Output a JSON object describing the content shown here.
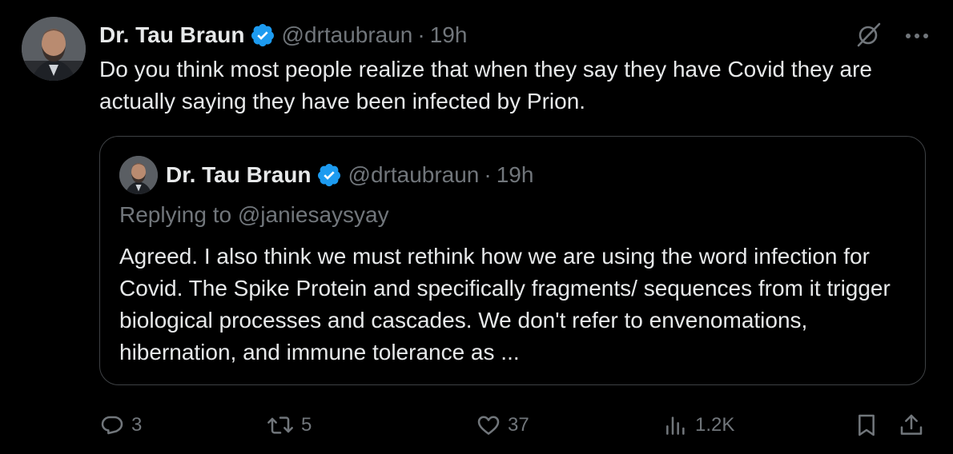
{
  "tweet": {
    "author_name": "Dr. Tau Braun",
    "handle": "@drtaubraun",
    "separator": "·",
    "time": "19h",
    "text": "Do you think most people realize that when they say they have Covid they are actually saying they have been infected by Prion.",
    "icons": [
      "grok-icon",
      "more-icon",
      "verified-badge-icon"
    ]
  },
  "quote": {
    "author_name": "Dr. Tau Braun",
    "handle": "@drtaubraun",
    "separator": "·",
    "time": "19h",
    "replying_to": "Replying to @janiesaysyay",
    "text": "Agreed. I also think we must rethink how we are using the word infection for Covid. The Spike Protein and specifically fragments/ sequences from it trigger biological processes and cascades. We don't refer to envenomations, hibernation, and immune tolerance as ..."
  },
  "actions": {
    "replies": "3",
    "reposts": "5",
    "likes": "37",
    "views": "1.2K"
  },
  "colors": {
    "background": "#000000",
    "primary_text": "#e7e9ea",
    "secondary_text": "#71767b",
    "verified_blue": "#1d9bf0",
    "border": "#3e4144"
  }
}
